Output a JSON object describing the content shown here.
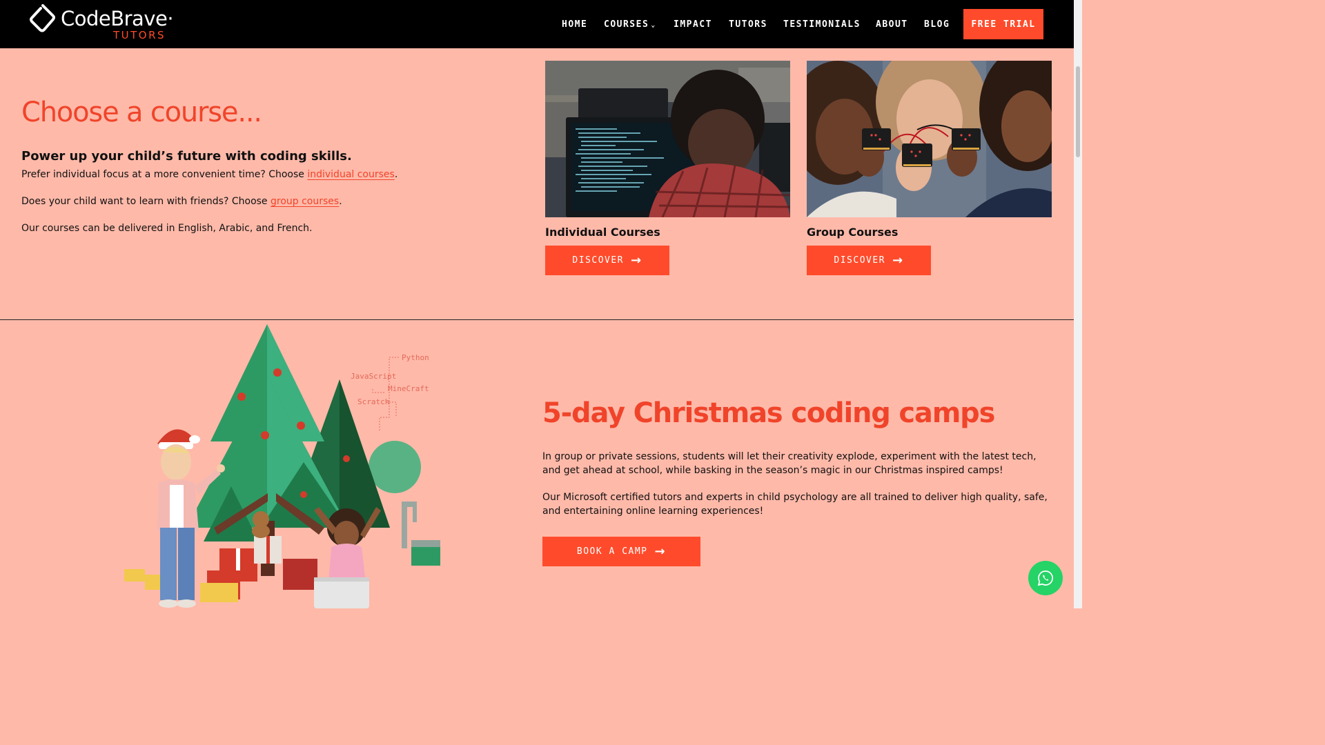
{
  "header": {
    "logo_name": "CodeBrave·",
    "logo_sub": "TUTORS",
    "nav": [
      "HOME",
      "COURSES",
      "IMPACT",
      "TUTORS",
      "TESTIMONIALS",
      "ABOUT",
      "BLOG"
    ],
    "cta": "FREE TRIAL"
  },
  "courses": {
    "title": "Choose a course...",
    "lead": "Power up your child’s future with coding skills.",
    "p1_text": "Prefer individual focus at a more convenient time? Choose ",
    "p1_link": "individual courses",
    "p1_end": ".",
    "p2_text": "Does your child want to learn with friends? Choose ",
    "p2_link": "group courses",
    "p2_end": ".",
    "p3": "Our courses can be delivered in English, Arabic, and French.",
    "cards": [
      {
        "title": "Individual Courses",
        "button": "DISCOVER"
      },
      {
        "title": "Group Courses",
        "button": "DISCOVER"
      }
    ]
  },
  "camps": {
    "title": "5-day Christmas coding camps",
    "p1": "In group or private sessions, students will let their creativity explode, experiment with the latest tech, and get ahead at school, while basking in the season’s magic in our Christmas inspired camps!",
    "p2": "Our Microsoft certified tutors and experts in child psychology are all trained to deliver high quality, safe, and entertaining online learning experiences!",
    "button": "BOOK A CAMP",
    "illustration_labels": [
      "Python",
      "JavaScript",
      "MineCraft",
      "Scratch"
    ]
  },
  "colors": {
    "accent": "#FF4B2B",
    "background": "#FFB9A9",
    "header": "#000000",
    "whatsapp": "#25D366"
  },
  "icons": [
    "chevron-down-icon",
    "arrow-right-icon",
    "whatsapp-icon"
  ]
}
